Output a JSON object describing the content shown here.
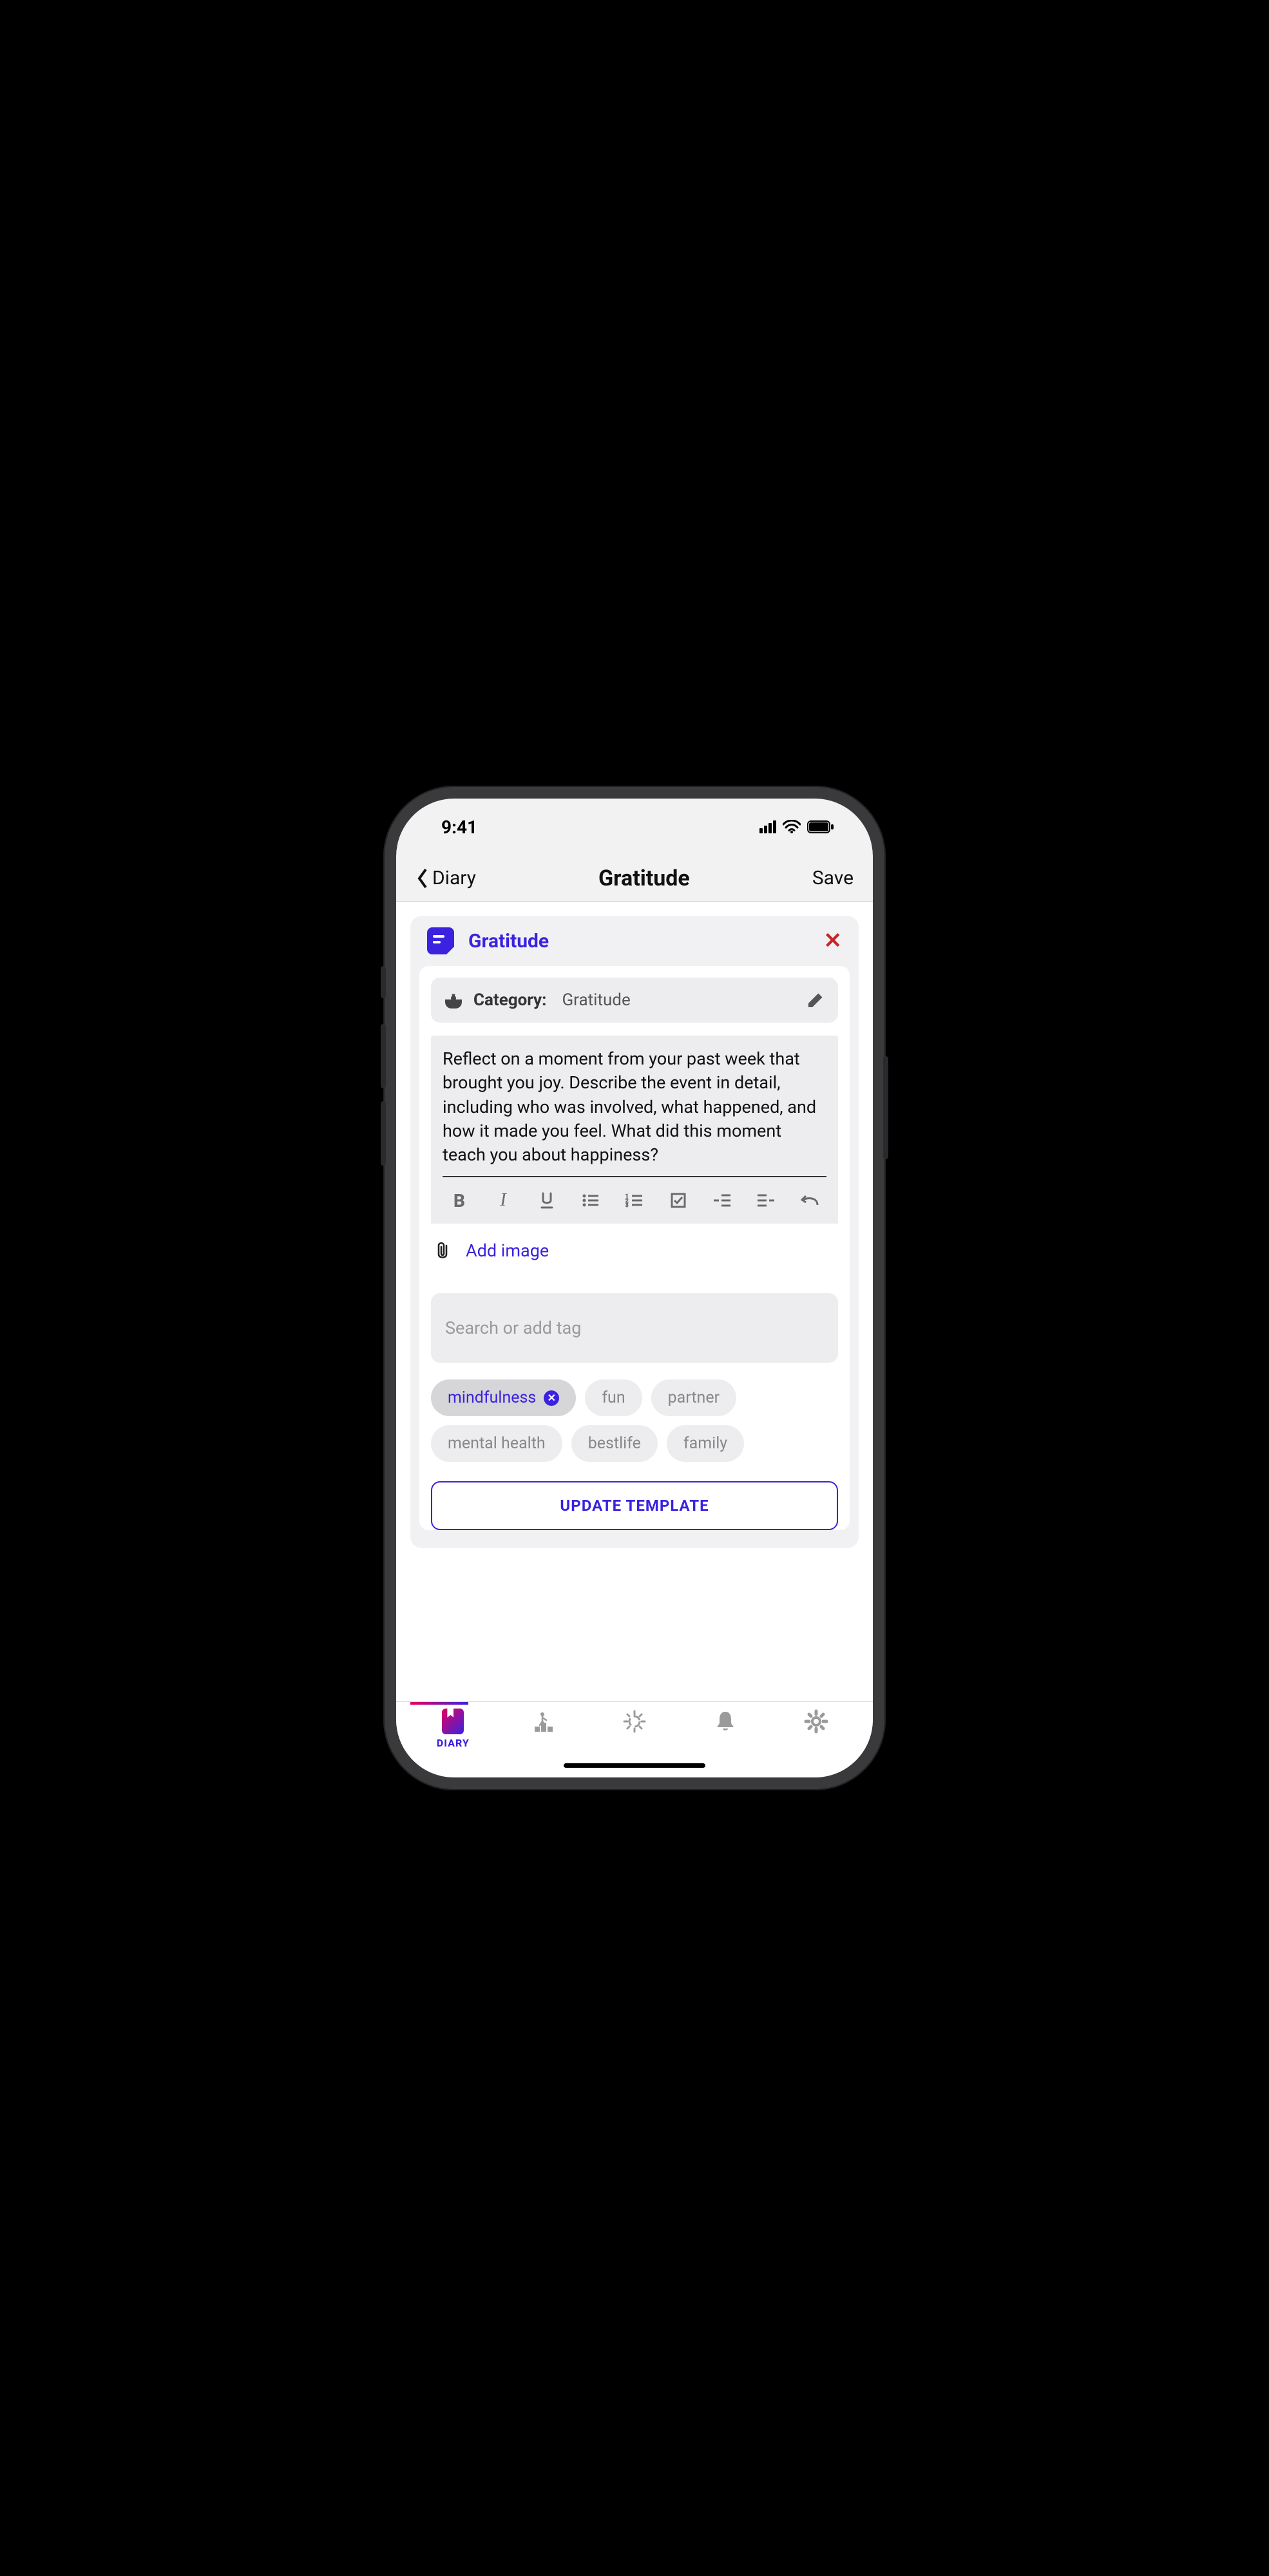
{
  "status": {
    "time": "9:41"
  },
  "nav": {
    "back_label": "Diary",
    "title": "Gratitude",
    "save_label": "Save"
  },
  "card": {
    "title": "Gratitude",
    "category_label": "Category:",
    "category_value": "Gratitude",
    "prompt_text": "Reflect on a moment from your past week that brought you joy. Describe the event in detail, including who was involved, what happened, and how it made you feel. What did this moment teach you about happiness?",
    "add_image_label": "Add image",
    "tag_search_placeholder": "Search or add tag",
    "update_button": "UPDATE TEMPLATE"
  },
  "tags": [
    {
      "label": "mindfulness",
      "selected": true
    },
    {
      "label": "fun",
      "selected": false
    },
    {
      "label": "partner",
      "selected": false
    },
    {
      "label": "mental health",
      "selected": false
    },
    {
      "label": "bestlife",
      "selected": false
    },
    {
      "label": "family",
      "selected": false
    }
  ],
  "tabbar": {
    "items": [
      {
        "label": "DIARY",
        "icon": "diary",
        "active": true
      },
      {
        "label": "",
        "icon": "stairs",
        "active": false
      },
      {
        "label": "",
        "icon": "sun",
        "active": false
      },
      {
        "label": "",
        "icon": "bell",
        "active": false
      },
      {
        "label": "",
        "icon": "gear",
        "active": false
      }
    ]
  },
  "colors": {
    "accent": "#3a22e0",
    "danger": "#c62828"
  }
}
